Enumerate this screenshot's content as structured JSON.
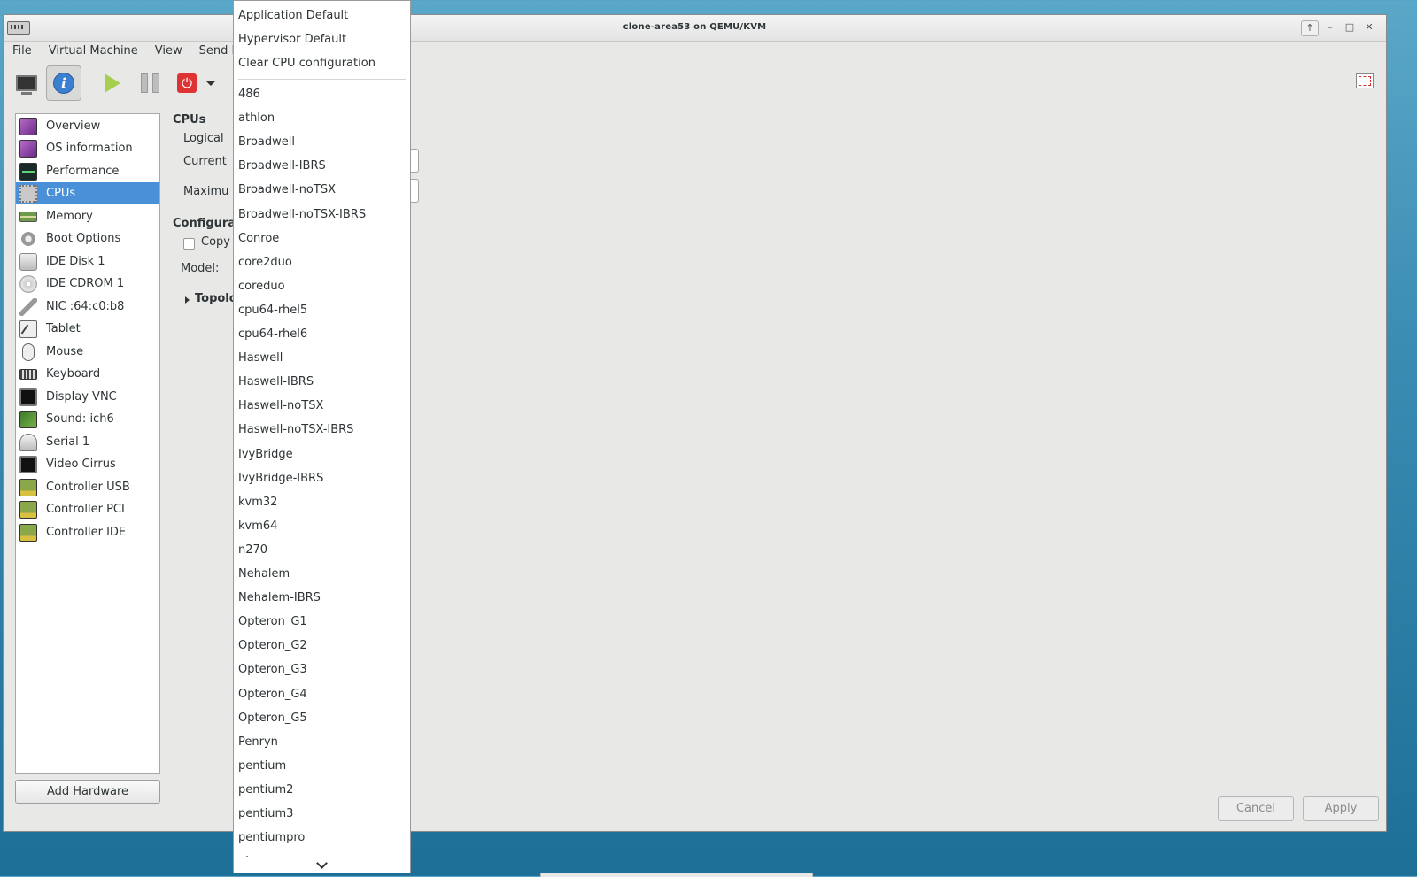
{
  "window": {
    "title": "clone-area53 on QEMU/KVM"
  },
  "wm_buttons": [
    "↑",
    "–",
    "□",
    "✕"
  ],
  "menubar": [
    "File",
    "Virtual Machine",
    "View",
    "Send Ke"
  ],
  "toolbar": {
    "buttons": [
      "monitor-icon",
      "info-icon",
      "play-icon",
      "pause-icon",
      "power-icon",
      "dropdown-arrow-icon",
      "fullscreen-icon"
    ],
    "active": "info-icon"
  },
  "hardware_list": {
    "selected": "CPUs",
    "items": [
      {
        "label": "Overview",
        "icon": "overview-icon"
      },
      {
        "label": "OS information",
        "icon": "os-info-icon"
      },
      {
        "label": "Performance",
        "icon": "performance-icon"
      },
      {
        "label": "CPUs",
        "icon": "cpu-icon"
      },
      {
        "label": "Memory",
        "icon": "memory-icon"
      },
      {
        "label": "Boot Options",
        "icon": "boot-options-icon"
      },
      {
        "label": "IDE Disk 1",
        "icon": "disk-icon"
      },
      {
        "label": "IDE CDROM 1",
        "icon": "cdrom-icon"
      },
      {
        "label": "NIC :64:c0:b8",
        "icon": "nic-icon"
      },
      {
        "label": "Tablet",
        "icon": "tablet-icon"
      },
      {
        "label": "Mouse",
        "icon": "mouse-icon"
      },
      {
        "label": "Keyboard",
        "icon": "keyboard-icon"
      },
      {
        "label": "Display VNC",
        "icon": "display-icon"
      },
      {
        "label": "Sound: ich6",
        "icon": "sound-icon"
      },
      {
        "label": "Serial 1",
        "icon": "serial-icon"
      },
      {
        "label": "Video Cirrus",
        "icon": "video-icon"
      },
      {
        "label": "Controller USB",
        "icon": "controller-icon"
      },
      {
        "label": "Controller PCI",
        "icon": "controller-icon"
      },
      {
        "label": "Controller IDE",
        "icon": "controller-icon"
      }
    ],
    "add_button": "Add Hardware"
  },
  "details": {
    "cpus_heading": "CPUs",
    "logical_label": "Logical",
    "current_label": "Current",
    "maximum_label": "Maximu",
    "config_heading": "Configura",
    "copy_label": "Copy",
    "model_label": "Model:",
    "topology_label": "Topolo"
  },
  "footer": {
    "cancel": "Cancel",
    "apply": "Apply"
  },
  "cpu_model_menu": {
    "top_items": [
      "Application Default",
      "Hypervisor Default",
      "Clear CPU configuration"
    ],
    "models": [
      "486",
      "athlon",
      "Broadwell",
      "Broadwell-IBRS",
      "Broadwell-noTSX",
      "Broadwell-noTSX-IBRS",
      "Conroe",
      "core2duo",
      "coreduo",
      "cpu64-rhel5",
      "cpu64-rhel6",
      "Haswell",
      "Haswell-IBRS",
      "Haswell-noTSX",
      "Haswell-noTSX-IBRS",
      "IvyBridge",
      "IvyBridge-IBRS",
      "kvm32",
      "kvm64",
      "n270",
      "Nehalem",
      "Nehalem-IBRS",
      "Opteron_G1",
      "Opteron_G2",
      "Opteron_G3",
      "Opteron_G4",
      "Opteron_G5",
      "Penryn",
      "pentium",
      "pentium2",
      "pentium3",
      "pentiumpro",
      "phenom"
    ]
  },
  "colors": {
    "selection": "#4a90d9",
    "window_bg": "#e8e8e7",
    "desktop": "#3b8cb3"
  }
}
